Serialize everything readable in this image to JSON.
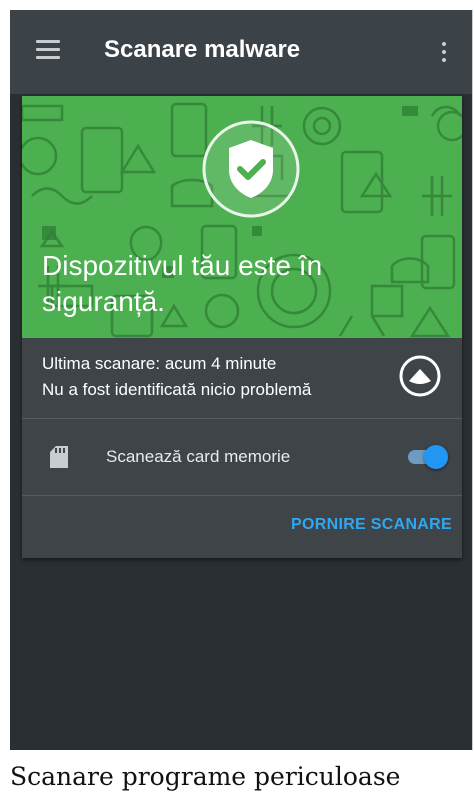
{
  "appbar": {
    "title": "Scanare malware",
    "menu_icon": "hamburger-menu-icon",
    "overflow_icon": "more-vert-icon"
  },
  "hero": {
    "status_text": "Dispozitivul tău este în siguranță.",
    "icon": "shield-check-icon",
    "background_color": "#4caf50"
  },
  "scan_status": {
    "last_scan": "Ultima scanare: acum 4 minute",
    "result": "Nu a fost identificată nicio problemă",
    "collapse_icon": "chevron-up-circle-icon"
  },
  "memory_card": {
    "label": "Scanează card memorie",
    "icon": "sd-card-icon",
    "enabled": true
  },
  "actions": {
    "start_scan": "PORNIRE SCANARE",
    "accent_color": "#2ea8f0"
  },
  "caption": "Scanare programe periculoase"
}
